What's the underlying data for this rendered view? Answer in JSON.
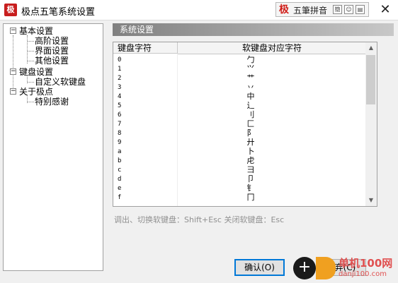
{
  "window": {
    "app_icon_text": "极",
    "title": "极点五笔系统设置",
    "close": "✕"
  },
  "ime_toolbar": {
    "logo": "极",
    "label": "五筆拼音",
    "icons": [
      "簡",
      "☺",
      "▤"
    ]
  },
  "tree": {
    "items": [
      {
        "label": "基本设置",
        "expanded": true
      },
      {
        "label": "高阶设置"
      },
      {
        "label": "界面设置"
      },
      {
        "label": "其他设置"
      },
      {
        "label": "键盘设置",
        "expanded": true
      },
      {
        "label": "自定义软键盘"
      },
      {
        "label": "关于极点",
        "expanded": true
      },
      {
        "label": "特别感谢"
      }
    ]
  },
  "section": {
    "title": "系统设置"
  },
  "table": {
    "headers": [
      "键盘字符",
      "软键盘对应字符"
    ],
    "rows": [
      {
        "key": "0",
        "value": "勹"
      },
      {
        "key": "1",
        "value": "⺍"
      },
      {
        "key": "2",
        "value": "⺾"
      },
      {
        "key": "3",
        "value": "丷"
      },
      {
        "key": "4",
        "value": "中"
      },
      {
        "key": "5",
        "value": "辶"
      },
      {
        "key": "6",
        "value": "刂"
      },
      {
        "key": "7",
        "value": "匚"
      },
      {
        "key": "8",
        "value": "阝"
      },
      {
        "key": "9",
        "value": "廾"
      },
      {
        "key": "a",
        "value": "卜"
      },
      {
        "key": "b",
        "value": "虍"
      },
      {
        "key": "c",
        "value": "彐"
      },
      {
        "key": "d",
        "value": "卩"
      },
      {
        "key": "e",
        "value": "钅"
      },
      {
        "key": "f",
        "value": "冂"
      }
    ]
  },
  "scrollbar": {
    "up": "▲",
    "down": "▼"
  },
  "hint": "调出、切换软键盘：Shift+Esc    关闭软键盘：Esc",
  "buttons": {
    "ok": "确认(O)",
    "cancel": "放弃(C)"
  },
  "watermark": {
    "symbol": "+",
    "line1": "单机100网",
    "line2": "danji100.com"
  }
}
